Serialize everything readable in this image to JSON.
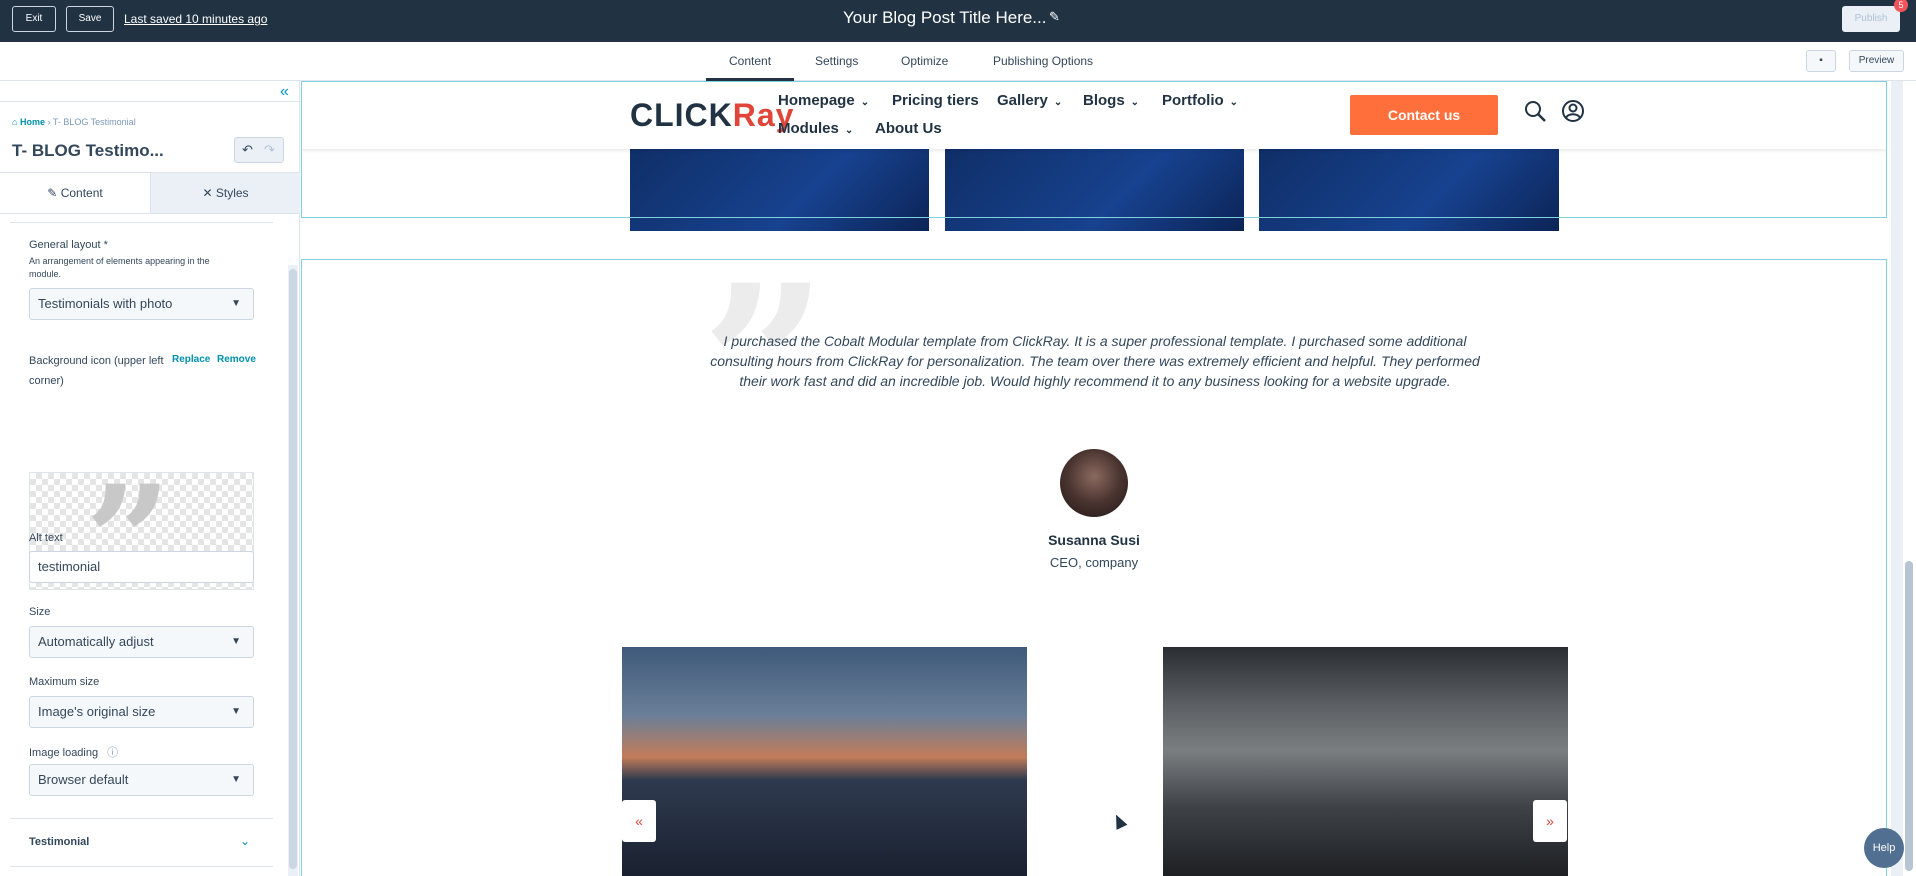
{
  "topbar": {
    "exit_label": "Exit",
    "save_label": "Save",
    "last_saved": "Last saved 10 minutes ago",
    "post_title": "Your Blog Post Title Here...",
    "publish_label": "Publish",
    "notification_count": "5"
  },
  "tabs": [
    {
      "label": "Content",
      "active": true
    },
    {
      "label": "Settings"
    },
    {
      "label": "Optimize"
    },
    {
      "label": "Publishing Options"
    }
  ],
  "toolbar_right": {
    "preview_label": "Preview"
  },
  "left_panel": {
    "breadcrumb": {
      "home": "Home",
      "current": "T- BLOG Testimonial"
    },
    "heading": "T- BLOG Testimo...",
    "panel_tabs": {
      "content": "Content",
      "styles": "Styles"
    },
    "general_layout": {
      "label": "General layout *",
      "help": "An arrangement of elements appearing in the module.",
      "value": "Testimonials with photo"
    },
    "background_icon": {
      "label": "Background icon (upper left corner)",
      "replace": "Replace",
      "remove": "Remove"
    },
    "alt_text": {
      "label": "Alt text",
      "value": "testimonial"
    },
    "size": {
      "label": "Size",
      "value": "Automatically adjust"
    },
    "max_size": {
      "label": "Maximum size",
      "value": "Image's original size"
    },
    "image_loading": {
      "label": "Image loading",
      "value": "Browser default"
    },
    "section_testimonial": "Testimonial"
  },
  "site": {
    "logo_text_a": "CLICK",
    "logo_text_b": "Ray",
    "nav": [
      {
        "label": "Homepage",
        "has_dropdown": true
      },
      {
        "label": "Pricing tiers",
        "has_dropdown": false
      },
      {
        "label": "Gallery",
        "has_dropdown": true
      },
      {
        "label": "Blogs",
        "has_dropdown": true
      },
      {
        "label": "Portfolio",
        "has_dropdown": true
      },
      {
        "label": "Modules",
        "has_dropdown": true
      },
      {
        "label": "About Us",
        "has_dropdown": false
      }
    ],
    "contact_label": "Contact us",
    "testimonial": {
      "quote": "I purchased the Cobalt Modular template from ClickRay. It is a super professional template. I purchased some additional consulting hours from ClickRay for personalization. The team over there was extremely efficient and helpful. They performed their work fast and did an incredible job. Would highly recommend it to any business looking for a website upgrade.",
      "name": "Susanna Susi",
      "role": "CEO, company"
    },
    "prev_arrow": "«",
    "next_arrow": "»"
  },
  "help_label": "Help",
  "colors": {
    "topbar": "#213343",
    "accent": "#ff6f3c",
    "link": "#0091ae",
    "selection": "#7fd1de"
  }
}
